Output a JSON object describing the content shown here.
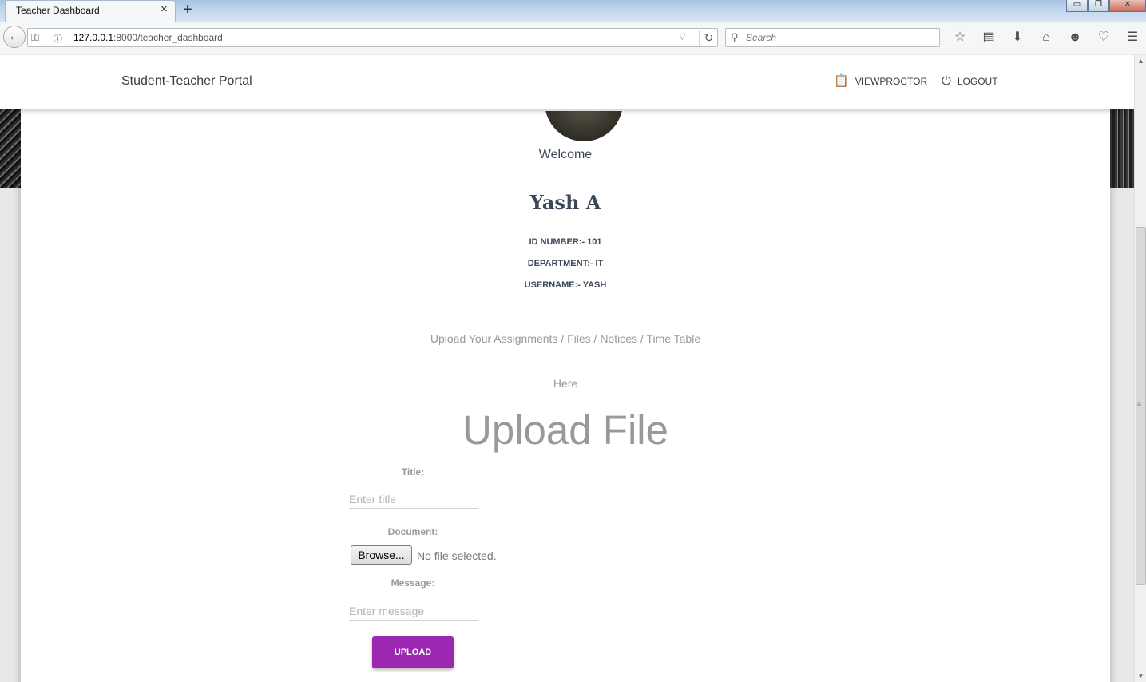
{
  "browser": {
    "tab_title": "Teacher Dashboard",
    "tab_close": "×",
    "new_tab": "+",
    "url_host": "127.0.0.1",
    "url_rest": ":8000/teacher_dashboard",
    "search_placeholder": "Search",
    "window_controls": {
      "minimize": "▭",
      "restore": "❐",
      "close": "✕"
    }
  },
  "header": {
    "brand": "Student-Teacher Portal",
    "nav": [
      {
        "label": "VIEWPROCTOR",
        "icon": "clipboard-icon"
      },
      {
        "label": "LOGOUT",
        "icon": "power-icon"
      }
    ]
  },
  "profile": {
    "welcome": "Welcome",
    "name": "Yash A",
    "id_number": "ID NUMBER:- 101",
    "department": "DEPARTMENT:- IT",
    "username": "USERNAME:- YASH"
  },
  "upload": {
    "description": "Upload Your Assignments / Files / Notices / Time Table",
    "here": "Here",
    "heading": "Upload File",
    "title_label": "Title:",
    "title_placeholder": "Enter title",
    "document_label": "Document:",
    "browse_label": "Browse...",
    "no_file": "No file selected.",
    "message_label": "Message:",
    "message_placeholder": "Enter message",
    "submit_label": "UPLOAD"
  },
  "colors": {
    "accent": "#9c27b0",
    "heading_text": "#3c4858",
    "muted_text": "#999999"
  }
}
